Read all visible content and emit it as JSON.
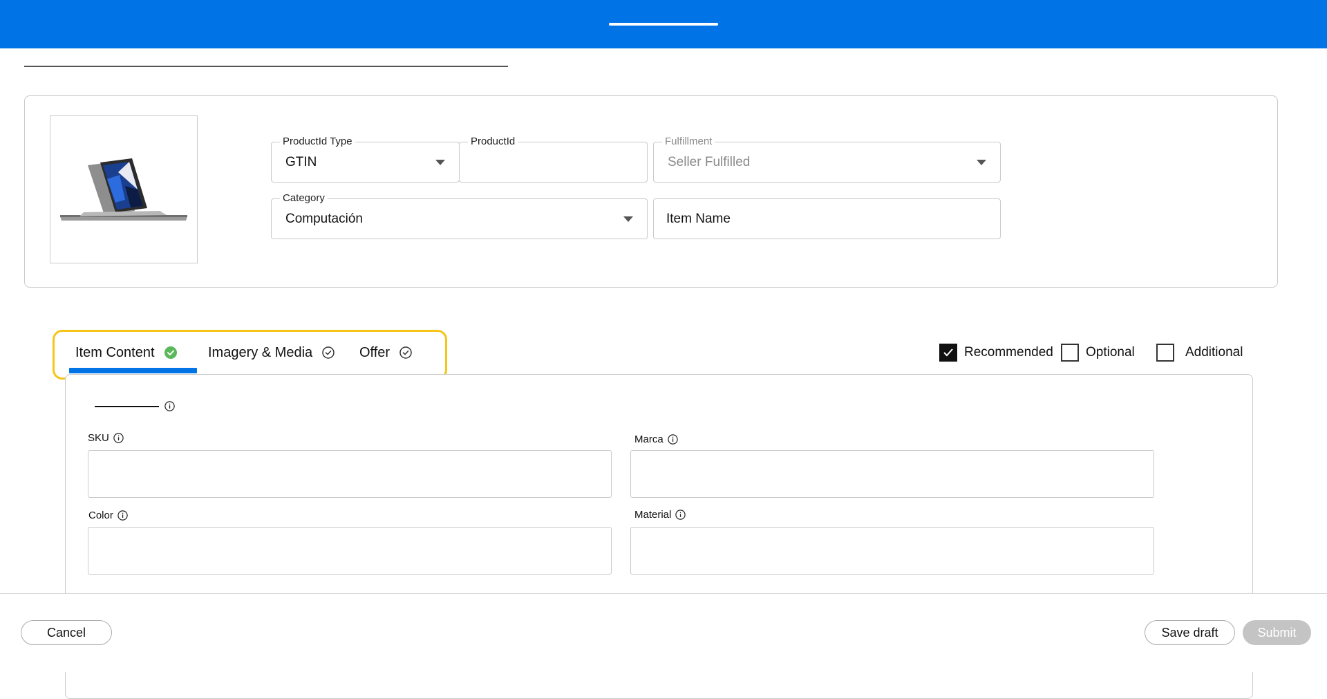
{
  "product": {
    "productid_type": {
      "label": "ProductId Type",
      "value": "GTIN"
    },
    "productid": {
      "label": "ProductId",
      "value": ""
    },
    "fulfillment": {
      "label": "Fulfillment",
      "value": "Seller Fulfilled"
    },
    "category": {
      "label": "Category",
      "value": "Computación"
    },
    "item_name": {
      "placeholder": "Item Name"
    }
  },
  "tabs": [
    {
      "label": "Item Content",
      "status": "complete",
      "active": true
    },
    {
      "label": "Imagery & Media",
      "status": "pending",
      "active": false
    },
    {
      "label": "Offer",
      "status": "pending",
      "active": false
    }
  ],
  "filters": [
    {
      "label": "Recommended",
      "checked": true
    },
    {
      "label": "Optional",
      "checked": false
    },
    {
      "label": "Additional",
      "checked": false
    }
  ],
  "attributes": {
    "sku": {
      "label": "SKU",
      "value": ""
    },
    "marca": {
      "label": "Marca",
      "value": ""
    },
    "color": {
      "label": "Color",
      "value": ""
    },
    "material": {
      "label": "Material",
      "value": ""
    }
  },
  "footer": {
    "cancel_label": "Cancel",
    "save_draft_label": "Save draft",
    "submit_label": "Submit"
  },
  "colors": {
    "brand_blue": "#0073e6",
    "highlight_yellow": "#f5c518",
    "success_green": "#5cb85c",
    "disabled_gray": "#c4c4c4"
  }
}
